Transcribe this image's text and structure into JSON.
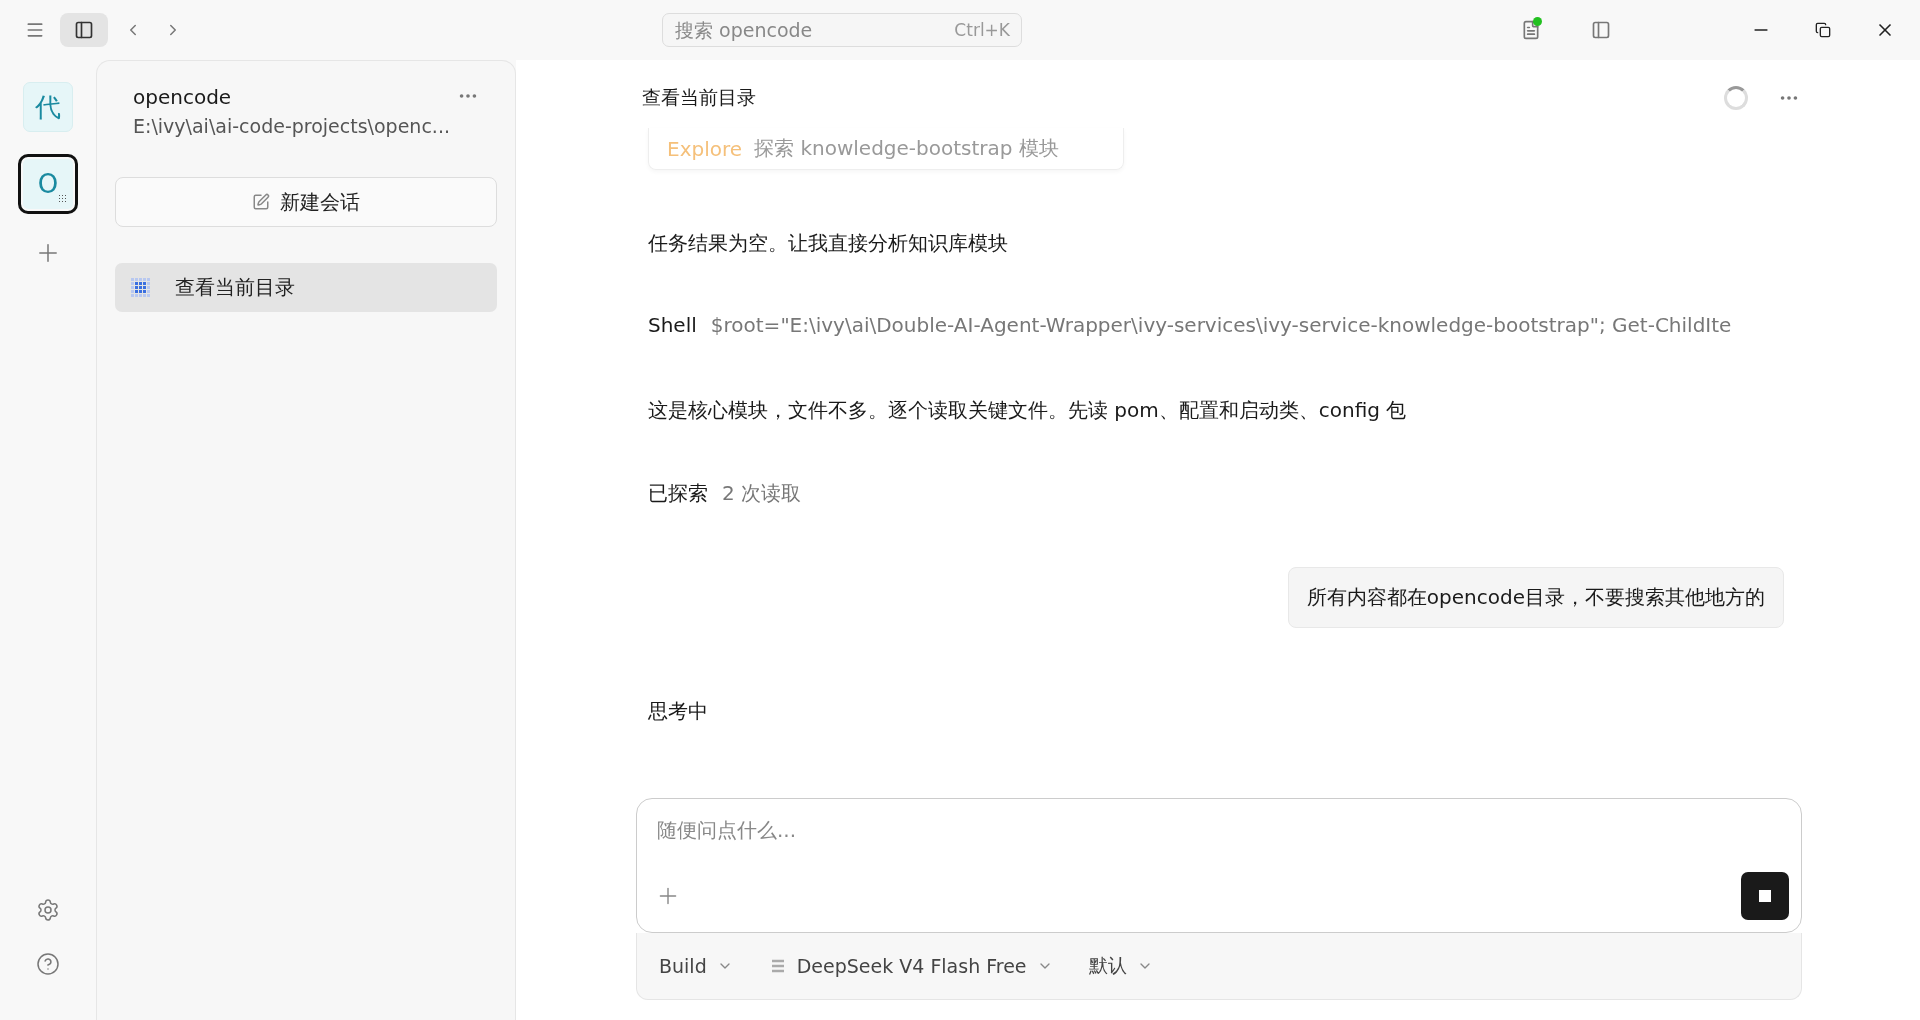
{
  "search": {
    "placeholder": "搜索 opencode",
    "shortcut": "Ctrl+K"
  },
  "rail": {
    "projects": [
      {
        "letter": "代",
        "selected": false,
        "busy": false
      },
      {
        "letter": "O",
        "selected": true,
        "busy": true
      }
    ]
  },
  "sidebar": {
    "project_name": "opencode",
    "project_path": "E:\\ivy\\ai\\ai-code-projects\\openc...",
    "new_session": "新建会话",
    "sessions": [
      {
        "title": "查看当前目录",
        "selected": true,
        "busy": true
      }
    ]
  },
  "chat": {
    "title": "查看当前目录",
    "busy": true,
    "messages": [
      {
        "kind": "task",
        "agent": "Explore",
        "text": "探索 knowledge-bootstrap 模块"
      },
      {
        "kind": "text",
        "text": "任务结果为空。让我直接分析知识库模块"
      },
      {
        "kind": "tool",
        "tool": "Shell",
        "text": "$root=\"E:\\ivy\\ai\\Double-AI-Agent-Wrapper\\ivy-services\\ivy-service-knowledge-bootstrap\"; Get-ChildIte"
      },
      {
        "kind": "text",
        "text": "这是核心模块，文件不多。逐个读取关键文件。先读 pom、配置和启动类、config 包"
      },
      {
        "kind": "tool",
        "tool": "已探索",
        "text": "2 次读取"
      },
      {
        "kind": "user",
        "text": "所有内容都在opencode目录，不要搜索其他地方的"
      },
      {
        "kind": "status",
        "text": "思考中"
      }
    ]
  },
  "composer": {
    "placeholder": "随便问点什么...",
    "agent": "Build",
    "model": "DeepSeek V4 Flash Free",
    "variant": "默认"
  }
}
